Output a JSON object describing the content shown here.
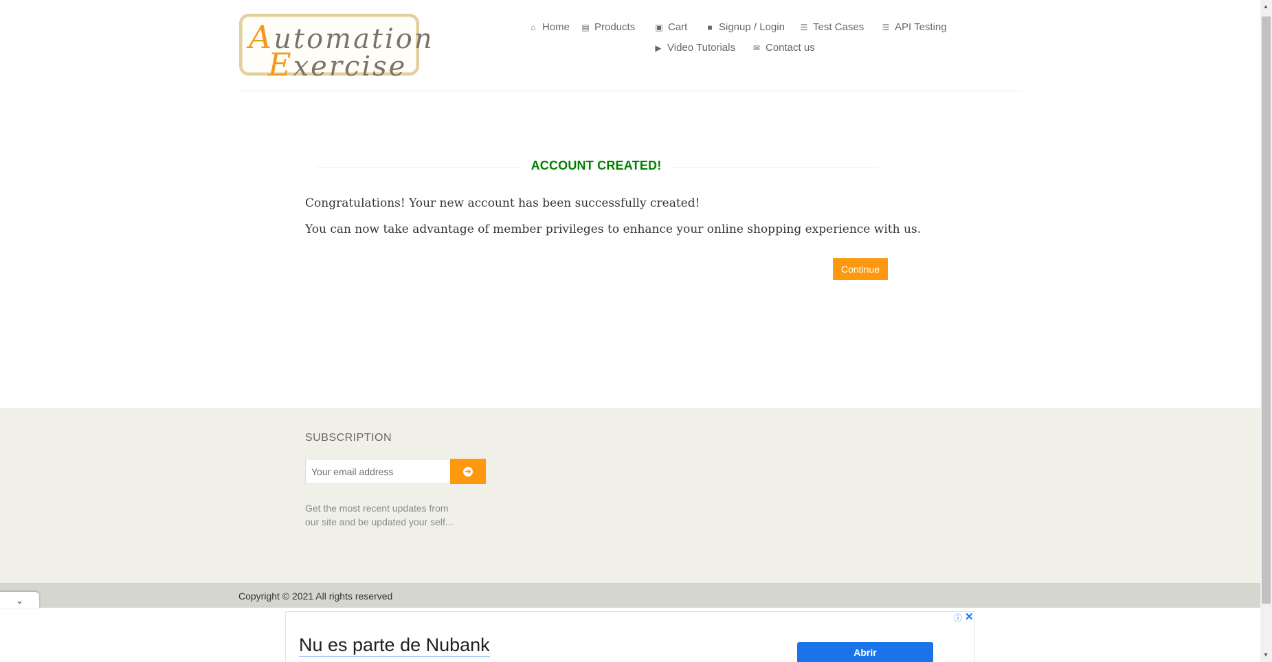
{
  "logo": {
    "line1_cap": "A",
    "line1_rest": "utomation",
    "line2_cap": "E",
    "line2_rest": "xercise"
  },
  "nav": {
    "items": [
      {
        "label": "Home",
        "icon": "home-icon"
      },
      {
        "label": "Products",
        "icon": "briefcase-icon"
      },
      {
        "label": "Cart",
        "icon": "cart-icon"
      },
      {
        "label": "Signup / Login",
        "icon": "lock-icon"
      },
      {
        "label": "Test Cases",
        "icon": "list-icon"
      },
      {
        "label": "API Testing",
        "icon": "list-icon"
      },
      {
        "label": "Video Tutorials",
        "icon": "youtube-play-icon"
      },
      {
        "label": "Contact us",
        "icon": "envelope-icon"
      }
    ]
  },
  "main": {
    "title": "ACCOUNT CREATED!",
    "message1": "Congratulations! Your new account has been successfully created!",
    "message2": "You can now take advantage of member privileges to enhance your online shopping experience with us.",
    "continue_label": "Continue"
  },
  "footer": {
    "subscription_title": "SUBSCRIPTION",
    "email_placeholder": "Your email address",
    "subscribe_desc_line1": "Get the most recent updates from",
    "subscribe_desc_line2": "our site and be updated your self...",
    "copyright": "Copyright © 2021 All rights reserved"
  },
  "ad": {
    "headline": "Nu es parte de Nubank",
    "cta": "Abrir"
  },
  "colors": {
    "accent": "#fe980f",
    "success": "#008000",
    "footer_bg": "#f0f0e9",
    "ad_button": "#1a73e8"
  }
}
